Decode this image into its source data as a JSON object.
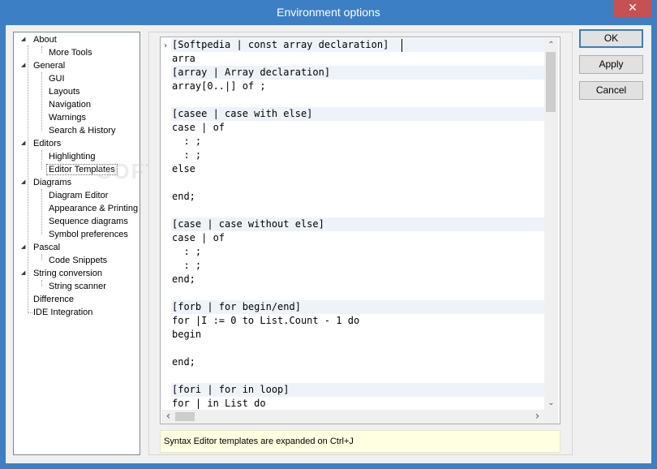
{
  "window": {
    "title": "Environment options",
    "close_glyph": "✕"
  },
  "tree": {
    "items": [
      {
        "label": "About",
        "expander": "◢"
      },
      {
        "label": "More Tools"
      },
      {
        "label": "General",
        "expander": "◢"
      },
      {
        "label": "GUI"
      },
      {
        "label": "Layouts"
      },
      {
        "label": "Navigation"
      },
      {
        "label": "Warnings"
      },
      {
        "label": "Search & History"
      },
      {
        "label": "Editors",
        "expander": "◢"
      },
      {
        "label": "Highlighting"
      },
      {
        "label": "Editor Templates",
        "selected": true
      },
      {
        "label": "Diagrams",
        "expander": "◢"
      },
      {
        "label": "Diagram Editor"
      },
      {
        "label": "Appearance & Printing"
      },
      {
        "label": "Sequence diagrams"
      },
      {
        "label": "Symbol preferences"
      },
      {
        "label": "Pascal",
        "expander": "◢"
      },
      {
        "label": "Code Snippets"
      },
      {
        "label": "String conversion",
        "expander": "◢"
      },
      {
        "label": "String scanner"
      },
      {
        "label": "Difference"
      },
      {
        "label": "IDE Integration"
      }
    ]
  },
  "editor": {
    "lines": [
      "[Softpedia | const array declaration]",
      "arra",
      "[array | Array declaration]",
      "array[0..|] of ;",
      "",
      "[casee | case with else]",
      "case | of",
      "  : ;",
      "  : ;",
      "else",
      "",
      "end;",
      "",
      "[case | case without else]",
      "case | of",
      "  : ;",
      "  : ;",
      "end;",
      "",
      "[forb | for begin/end]",
      "for |I := 0 to List.Count - 1 do",
      "begin",
      "",
      "end;",
      "",
      "[fori | for in loop]",
      "for | in List do"
    ],
    "current_line_marker": "›",
    "scroll_up": "⌃",
    "scroll_down": "⌄",
    "scroll_left": "‹",
    "scroll_right": "›"
  },
  "hint": {
    "text": "Syntax Editor templates are expanded on Ctrl+J"
  },
  "buttons": {
    "ok": "OK",
    "apply": "Apply",
    "cancel": "Cancel"
  },
  "watermark": "SOFTPEDIA"
}
